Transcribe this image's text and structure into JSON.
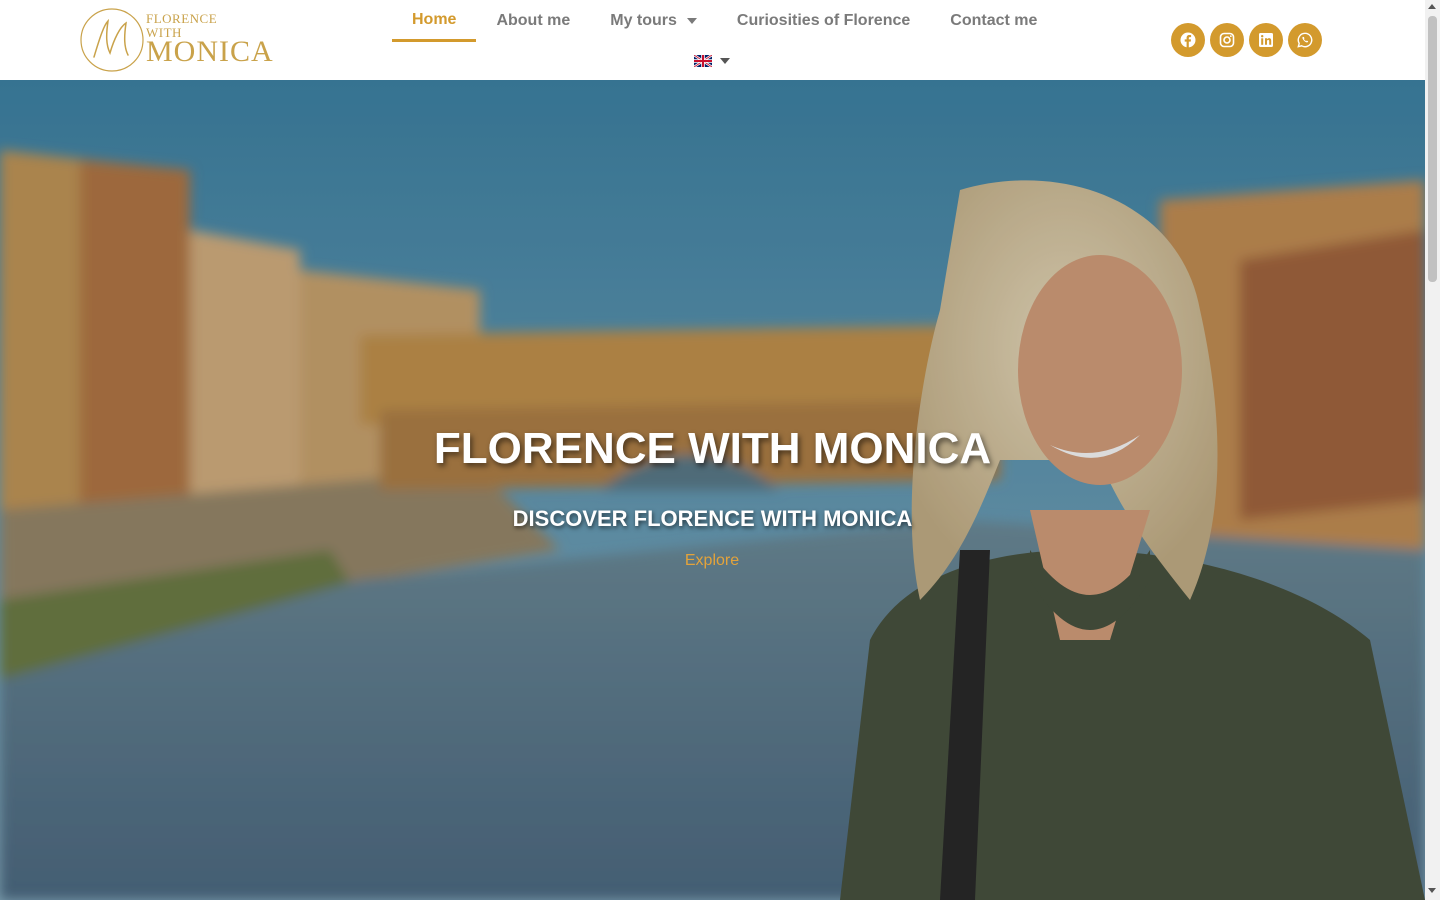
{
  "logo": {
    "line1": "FLORENCE",
    "line2": "WITH",
    "line3": "MONICA",
    "monogram": "M"
  },
  "nav": {
    "items": [
      {
        "label": "Home",
        "active": true
      },
      {
        "label": "About me"
      },
      {
        "label": "My tours",
        "has_dropdown": true
      },
      {
        "label": "Curiosities of Florence"
      },
      {
        "label": "Contact me"
      }
    ],
    "language_icon": "uk-flag-icon"
  },
  "social": [
    "facebook-icon",
    "instagram-icon",
    "linkedin-icon",
    "whatsapp-icon"
  ],
  "hero": {
    "title": "FLORENCE WITH MONICA",
    "subtitle": "DISCOVER FLORENCE WITH MONICA",
    "cta": "Explore"
  },
  "colors": {
    "accent": "#d39a2d",
    "nav_text": "#7a7a7a",
    "cta": "#e3a33b"
  }
}
